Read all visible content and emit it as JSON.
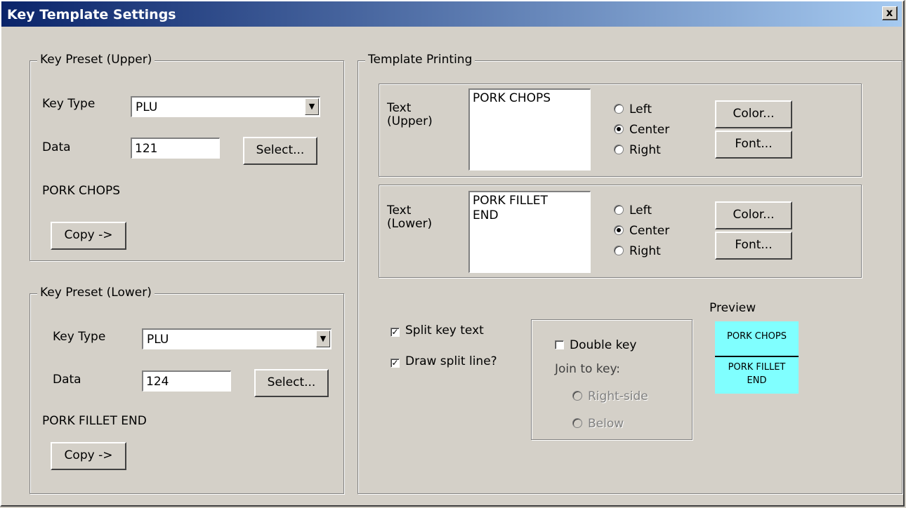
{
  "window": {
    "title": "Key Template Settings",
    "close_label": "x"
  },
  "upper_preset": {
    "legend": "Key Preset (Upper)",
    "key_type_label": "Key Type",
    "key_type_value": "PLU",
    "data_label": "Data",
    "data_value": "121",
    "select_label": "Select...",
    "item_name": "PORK CHOPS",
    "copy_label": "Copy ->"
  },
  "lower_preset": {
    "legend": "Key Preset (Lower)",
    "key_type_label": "Key Type",
    "key_type_value": "PLU",
    "data_label": "Data",
    "data_value": "124",
    "select_label": "Select...",
    "item_name": "PORK FILLET END",
    "copy_label": "Copy ->"
  },
  "template_printing": {
    "legend": "Template Printing",
    "upper": {
      "label_line1": "Text",
      "label_line2": "(Upper)",
      "text": "PORK CHOPS",
      "align_left": "Left",
      "align_center": "Center",
      "align_right": "Right",
      "selected_align": "Center",
      "color_label": "Color...",
      "font_label": "Font..."
    },
    "lower": {
      "label_line1": "Text",
      "label_line2": "(Lower)",
      "text": "PORK FILLET\nEND",
      "align_left": "Left",
      "align_center": "Center",
      "align_right": "Right",
      "selected_align": "Center",
      "color_label": "Color...",
      "font_label": "Font..."
    },
    "split_key_text": {
      "label": "Split key text",
      "checked": true
    },
    "draw_split_line": {
      "label": "Draw split line?",
      "checked": true
    },
    "double_key": {
      "label": "Double key",
      "checked": false
    },
    "join_to_key_label": "Join to key:",
    "join_right_side": "Right-side",
    "join_below": "Below",
    "preview_label": "Preview",
    "preview_upper": "PORK CHOPS",
    "preview_lower_line1": "PORK FILLET",
    "preview_lower_line2": "END",
    "preview_color": "#80ffff"
  },
  "icons": {
    "check": "checkmark-icon",
    "dropdown": "dropdown-arrow-icon"
  }
}
